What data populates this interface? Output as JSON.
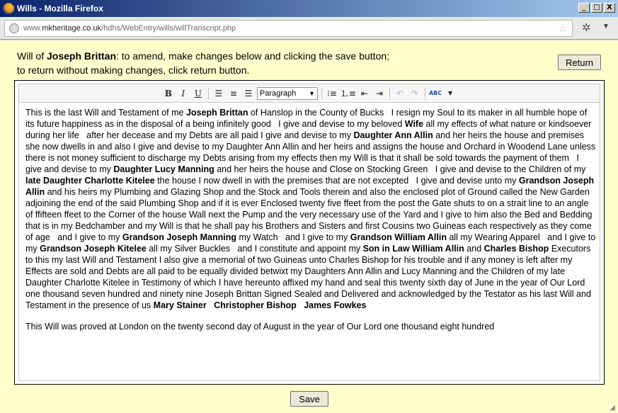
{
  "window": {
    "title": "Wills - Mozilla Firefox",
    "minimize": "_",
    "maximize": "□",
    "close": "X"
  },
  "browser": {
    "url_prefix": "www.",
    "url_domain": "mkheritage.co.uk",
    "url_path": "/hdhs/WebEntry/wills/willTranscript.php"
  },
  "header": {
    "prefix": "Will of ",
    "name": "Joseph Brittan",
    "line1_rest": ": to amend, make changes below and clicking the save button;",
    "line2": "to return without making changes, click return button.",
    "return_label": "Return"
  },
  "toolbar": {
    "bold": "B",
    "italic": "I",
    "underline": "U",
    "format_value": "Paragraph",
    "spellcheck": "ABC"
  },
  "will_text": [
    {
      "t": "This is the last Will and Testament of me "
    },
    {
      "t": "Joseph Brittan",
      "b": true
    },
    {
      "t": " of Hanslop in the County of Bucks   I resign my Soul to its maker in all humble hope of its future happiness as in the disposal of a being infinitely good   I give and devise to my beloved "
    },
    {
      "t": "Wife",
      "b": true
    },
    {
      "t": " all my effects of what nature or kindsoever during her life   after her decease and my Debts are all paid I give and devise to my "
    },
    {
      "t": "Daughter Ann Allin",
      "b": true
    },
    {
      "t": " and her heirs the house and premises she now dwells in and also I give and devise to my Daughter Ann Allin and her heirs and assigns the house and Orchard in Woodend Lane unless there is not money sufficient to discharge my Debts arising from my effects then my Will is that it shall be sold towards the payment of them   I give and devise to my "
    },
    {
      "t": "Daughter Lucy Manning",
      "b": true
    },
    {
      "t": " and her heirs the house and Close on Stocking Green   I give and devise to the Children of my "
    },
    {
      "t": "late Daughter Charlotte Kitelee",
      "b": true
    },
    {
      "t": " the house I now dwell in with the premises that are not excepted   I give and devise unto my "
    },
    {
      "t": "Grandson Joseph Allin",
      "b": true
    },
    {
      "t": " and his heirs my Plumbing and Glazing Shop and the Stock and Tools therein and also the enclosed plot of Ground called the New Garden adjoining the end of the said Plumbing Shop and if it is ever Enclosed twenty five ffeet from the post the Gate shuts to on a strait line to an angle of ffifteen ffeet to the Corner of the house Wall next the Pump and the very necessary use of the Yard and I give to him also the Bed and Bedding that is in my Bedchamber and my Will is that he shall pay his Brothers and Sisters and first Cousins two Guineas each respectively as they come of age   and I give to my "
    },
    {
      "t": "Grandson Joseph Manning",
      "b": true
    },
    {
      "t": " my Watch   and I give to my "
    },
    {
      "t": "Grandson William Allin",
      "b": true
    },
    {
      "t": " all my Wearing Apparel   and I give to my "
    },
    {
      "t": "Grandson Joseph Kitelee",
      "b": true
    },
    {
      "t": " all my Silver Buckles   and I constitute and appoint my "
    },
    {
      "t": "Son in Law William Allin",
      "b": true
    },
    {
      "t": " and "
    },
    {
      "t": "Charles Bishop",
      "b": true
    },
    {
      "t": " Executors to this my last Will and Testament I also give a memorial of two Guineas unto Charles Bishop for his trouble and if any money is left after my Effects are sold and Debts are all paid to be equally divided betwixt my Daughters Ann Allin and Lucy Manning and the Children of my late Daughter Charlotte Kitelee in Testimony of which I have hereunto affixed my hand and seal this twenty sixth day of June in the year of Our Lord one thousand seven hundred and ninety nine Joseph Brittan Signed Sealed and Delivered and acknowledged by the Testator as his last Will and Testament in the presence of us "
    },
    {
      "t": "Mary Stainer   Christopher Bishop   James Fowkes",
      "b": true
    }
  ],
  "probate_text": "This Will was proved at London on the twenty second day of August in the year of Our Lord one thousand eight hundred",
  "footer": {
    "save_label": "Save"
  }
}
